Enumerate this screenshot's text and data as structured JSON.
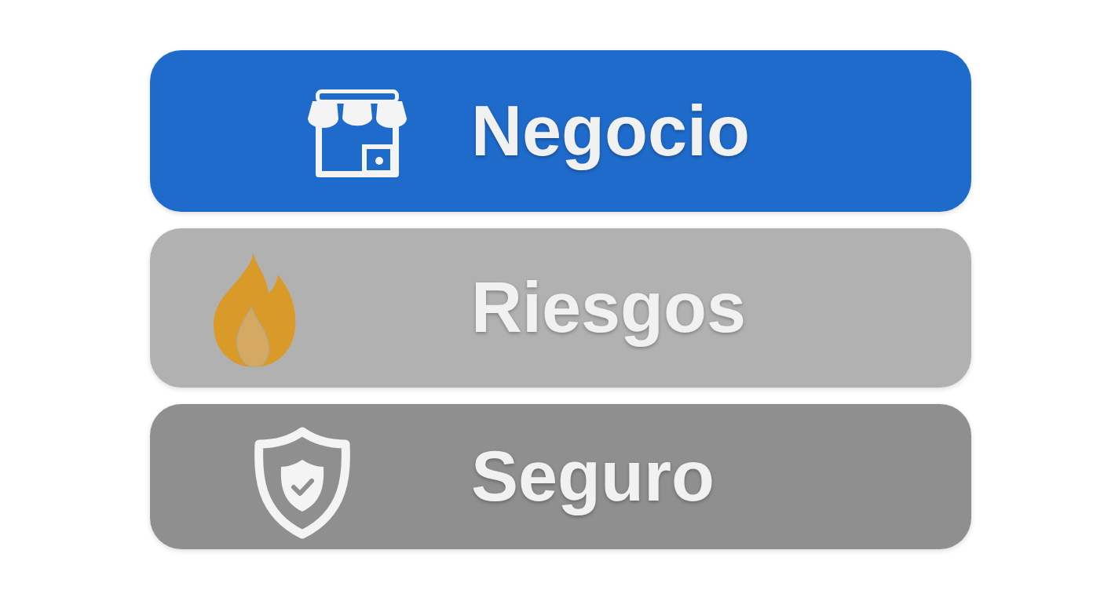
{
  "items": [
    {
      "label": "Negocio",
      "kind": "store",
      "color": "#1f6bcb"
    },
    {
      "label": "Riesgos",
      "kind": "flame",
      "color": "#b1b1b1"
    },
    {
      "label": "Seguro",
      "kind": "shield",
      "color": "#8f8f8f"
    }
  ]
}
